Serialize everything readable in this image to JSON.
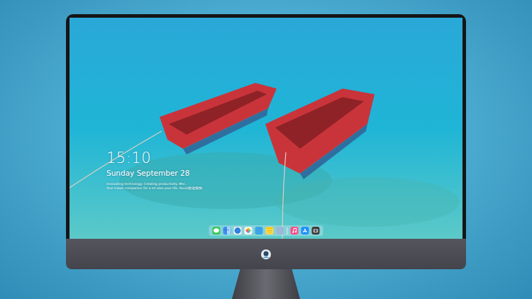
{
  "lock_screen": {
    "time": "15:10",
    "date": "Sunday September 28",
    "message_lines": [
      "Innovating technology. Creating productivity. Msc.",
      "Your travel companion for a lot else your life. Good旅途愉快"
    ]
  },
  "dock": {
    "items": [
      {
        "kind": "messages"
      },
      {
        "kind": "finder"
      },
      {
        "kind": "safari"
      },
      {
        "kind": "photos"
      },
      {
        "kind": "keynote"
      },
      {
        "kind": "notes"
      },
      {
        "kind": "preview"
      },
      {
        "kind": "separator"
      },
      {
        "kind": "music"
      },
      {
        "kind": "appstore"
      },
      {
        "kind": "camera"
      }
    ]
  }
}
